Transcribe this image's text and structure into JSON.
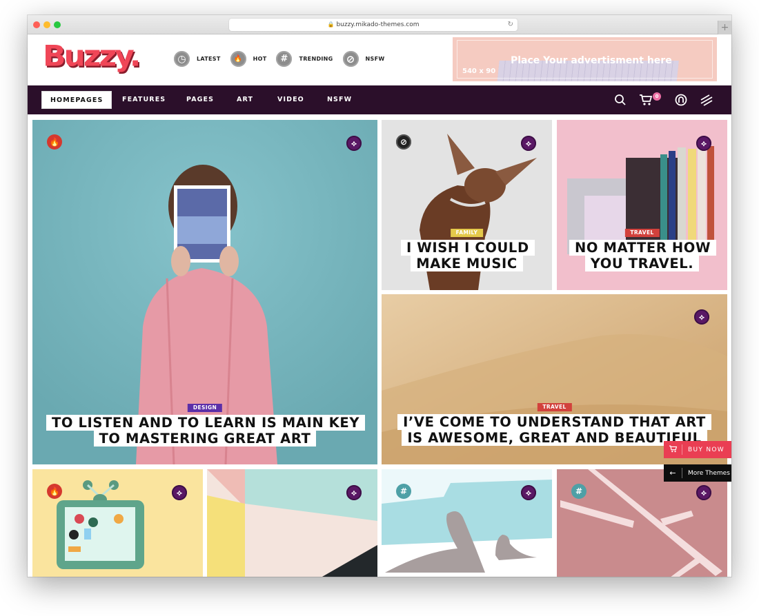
{
  "browser": {
    "url": "buzzy.mikado-themes.com",
    "lock_icon": "lock-icon",
    "reload_icon": "reload-icon",
    "new_tab_label": "+"
  },
  "header": {
    "logo": "Buzzy.",
    "quick_nav": [
      {
        "label": "LATEST",
        "icon": "clock-icon",
        "glyph": "◷"
      },
      {
        "label": "HOT",
        "icon": "flame-icon",
        "glyph": "🔥"
      },
      {
        "label": "TRENDING",
        "icon": "hashtag-icon",
        "glyph": "#"
      },
      {
        "label": "NSFW",
        "icon": "forbidden-icon",
        "glyph": "⊘"
      }
    ],
    "ad": {
      "title": "Place Your advertisment here",
      "size": "540 x 90"
    }
  },
  "nav": {
    "items": [
      "HOMEPAGES",
      "FEATURES",
      "PAGES",
      "ART",
      "VIDEO",
      "NSFW"
    ],
    "active": "HOMEPAGES",
    "cart_count": "0",
    "icons": {
      "search": "⌕",
      "cart": "🛒",
      "user": "◎",
      "menu": "⫽"
    }
  },
  "colors": {
    "brand": "#f04657",
    "nav_bg": "#2b0f2a",
    "design": "#5b2ea8",
    "family": "#e4c94a",
    "travel": "#d2413c",
    "buy_now": "#ea3e53"
  },
  "posts": [
    {
      "category": "DESIGN",
      "title": "TO LISTEN AND TO LEARN IS MAIN KEY TO MASTERING GREAT ART",
      "badge": "hot"
    },
    {
      "category": "FAMILY",
      "title": "I WISH I COULD MAKE MUSIC",
      "badge": "nsfw"
    },
    {
      "category": "TRAVEL",
      "title": "NO MATTER HOW YOU TRAVEL.",
      "badge": ""
    },
    {
      "category": "TRAVEL",
      "title": "I’VE COME TO UNDERSTAND THAT ART IS AWESOME, GREAT AND BEAUTIFUL",
      "badge": ""
    },
    {
      "category": "",
      "title": "",
      "badge": "hot"
    },
    {
      "category": "",
      "title": "",
      "badge": ""
    },
    {
      "category": "",
      "title": "",
      "badge": "trending"
    },
    {
      "category": "",
      "title": "",
      "badge": "trending"
    }
  ],
  "badge_glyphs": {
    "hot": "🔥",
    "share": "⟡",
    "nsfw": "⊘",
    "trending": "#"
  },
  "floating": {
    "buy_now": "BUY NOW",
    "more_themes": "More Themes",
    "cart_glyph": "🛒",
    "back_glyph": "←"
  }
}
